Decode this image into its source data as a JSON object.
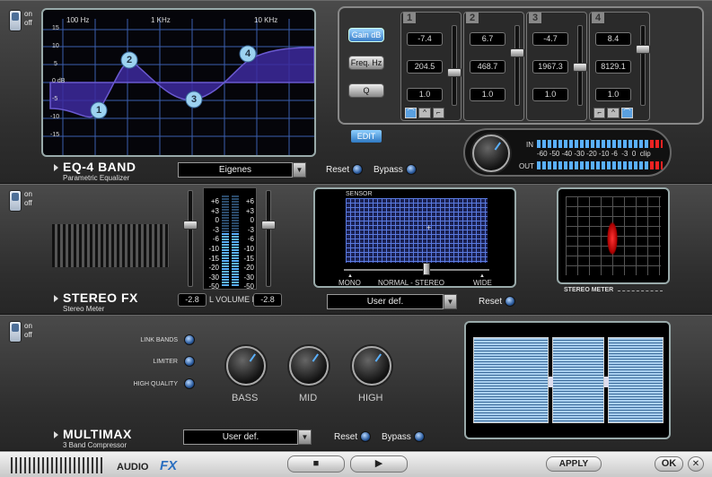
{
  "eq": {
    "switch": {
      "on": "on",
      "off": "off"
    },
    "freq_labels": [
      "100 Hz",
      "1 KHz",
      "10 KHz"
    ],
    "db_labels": [
      "15",
      "10",
      "5",
      "0 dB",
      "-5",
      "-10",
      "-15"
    ],
    "bands": [
      {
        "num": "1",
        "gain": "-7.4",
        "freq": "204.5",
        "q": "1.0"
      },
      {
        "num": "2",
        "gain": "6.7",
        "freq": "468.7",
        "q": "1.0"
      },
      {
        "num": "3",
        "gain": "-4.7",
        "freq": "1967.3",
        "q": "1.0"
      },
      {
        "num": "4",
        "gain": "8.4",
        "freq": "8129.1",
        "q": "1.0"
      }
    ],
    "param_labels": {
      "gain": "Gain dB",
      "freq": "Freq. Hz",
      "q": "Q"
    },
    "edit_label": "EDIT",
    "title": "EQ-4 BAND",
    "subtitle": "Parametric Equalizer",
    "preset": "Eigenes",
    "reset_label": "Reset",
    "bypass_label": "Bypass",
    "meter": {
      "in": "IN",
      "out": "OUT",
      "scale": "-60 -50 -40 -30 -20 -10 -6  -3  0  clip"
    }
  },
  "stereo": {
    "switch": {
      "on": "on",
      "off": "off"
    },
    "scale": [
      "+6",
      "+3",
      "0",
      "-3",
      "-6",
      "-10",
      "-15",
      "-20",
      "-30",
      "-50"
    ],
    "volume_l": "-2.8",
    "volume_r": "-2.8",
    "volume_label": "L VOLUME R",
    "sensor_label": "SENSOR",
    "mono_label": "MONO",
    "normal_label": "NORMAL - STEREO",
    "wide_label": "WIDE",
    "title": "STEREO FX",
    "subtitle": "Stereo Meter",
    "preset": "User def.",
    "reset_label": "Reset",
    "meter_label": "STEREO METER"
  },
  "multimax": {
    "switch": {
      "on": "on",
      "off": "off"
    },
    "options": [
      "LINK BANDS",
      "LIMITER",
      "HIGH QUALITY"
    ],
    "knobs": [
      "BASS",
      "MID",
      "HIGH"
    ],
    "title": "MULTIMAX",
    "subtitle": "3 Band Compressor",
    "preset": "User def.",
    "reset_label": "Reset",
    "bypass_label": "Bypass"
  },
  "footer": {
    "brand_a": "AUDIO",
    "brand_b": "FX",
    "stop": "■",
    "play": "▶",
    "apply": "APPLY",
    "ok": "OK",
    "close": "✕"
  }
}
